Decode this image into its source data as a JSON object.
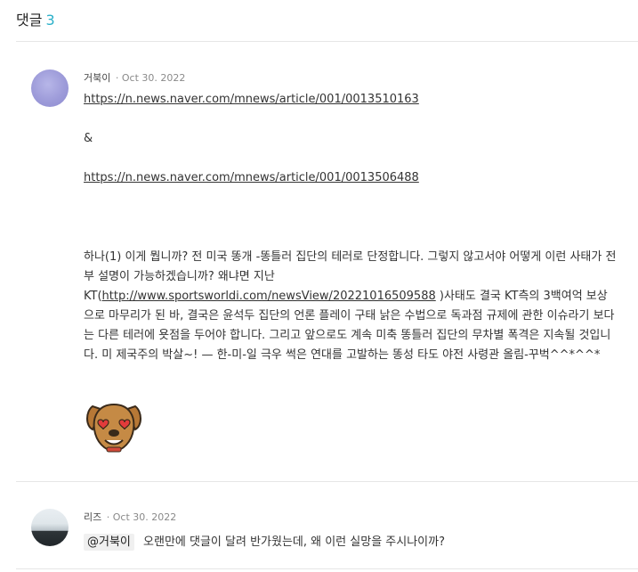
{
  "header": {
    "title": "댓글",
    "count": "3"
  },
  "comments": [
    {
      "author": "거북이",
      "date": "Oct 30. 2022",
      "link1": "https://n.news.naver.com/mnews/article/001/0013510163",
      "amp": "&",
      "link2": "https://n.news.naver.com/mnews/article/001/0013506488",
      "para_before": "하나(1) 이게 뭡니까? 전 미국 똥개 -똥틀러 집단의 테러로 단정합니다. 그렇지 않고서야 어떻게 이런 사태가 전부 설명이 가능하겠습니까? 왜냐면 지난 KT(",
      "para_link": "http://www.sportsworldi.com/newsView/20221016509588",
      "para_after": " )사태도 결국 KT측의 3백여억 보상으로 마무리가 된 바, 결국은 윤석두 집단의 언론 플레이 구태 낡은 수법으로 독과점 규제에 관한 이슈라기 보다는 다른 테러에 욧점을 두어야 합니다. 그리고 앞으로도 계속 미축 똥틀러 집단의 무차별 폭격은 지속될 것입니다. 미 제국주의 박살~! — 한-미-일 극우 썩은 연대를 고발하는 똥성 타도 야전 사령관 올림-꾸벅^^*^^*",
      "sticker": "heart-eyes-dog-sticker"
    },
    {
      "author": "리즈",
      "date": "Oct 30. 2022",
      "mention": "@거북이",
      "text": "오랜만에 댓글이 달려 반가웠는데, 왜 이런 실망을 주시나이까?"
    }
  ],
  "colors": {
    "accent": "#2bb0c9",
    "divider": "#e6e6e6"
  }
}
